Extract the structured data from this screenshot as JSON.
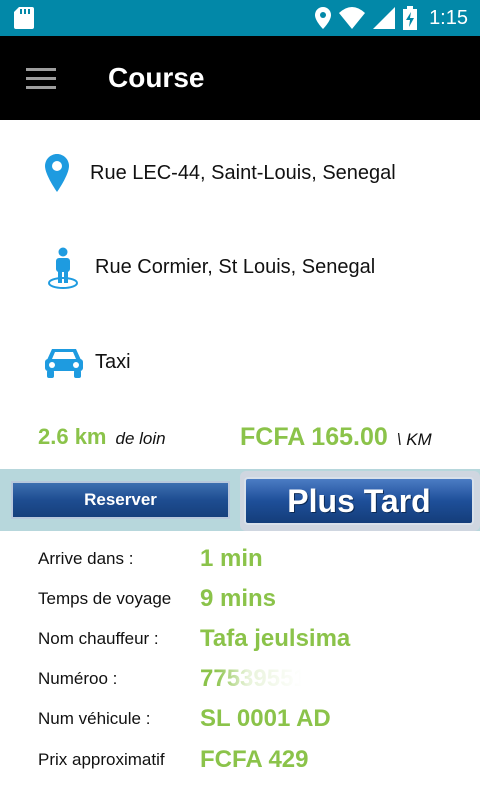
{
  "status": {
    "time": "1:15",
    "icons": [
      "sd-card-icon",
      "location-icon",
      "wifi-icon",
      "signal-icon",
      "battery-charging-icon"
    ]
  },
  "appbar": {
    "title": "Course"
  },
  "pickup": {
    "address": "Rue LEC-44, Saint-Louis, Senegal",
    "icon": "location-pin-icon"
  },
  "destination": {
    "address": "Rue Cormier, St Louis, Senegal",
    "icon": "person-pin-icon"
  },
  "vehicle": {
    "type": "Taxi",
    "icon": "car-icon"
  },
  "distance": {
    "value": "2.6 km",
    "suffix": "de loin"
  },
  "rate": {
    "price": "FCFA 165.00",
    "unit": "\\ KM"
  },
  "buttons": {
    "reserver": "Reserver",
    "plus_tard": "Plus Tard"
  },
  "details": [
    {
      "label": "Arrive dans :",
      "value": "1 min"
    },
    {
      "label": "Temps de voyage",
      "value": "9 mins"
    },
    {
      "label": "Nom chauffeur :",
      "value": "Tafa jeulsima"
    },
    {
      "label": "Numéroo :",
      "value": "775395517"
    },
    {
      "label": "Num véhicule :",
      "value": "SL 0001 AD"
    },
    {
      "label": "Prix approximatif",
      "value": "FCFA 429"
    }
  ],
  "colors": {
    "statusbar": "#0288a8",
    "accent_blue": "#1e9be0",
    "value_green": "#8bc34a",
    "button_blue": "#1e4d91"
  }
}
